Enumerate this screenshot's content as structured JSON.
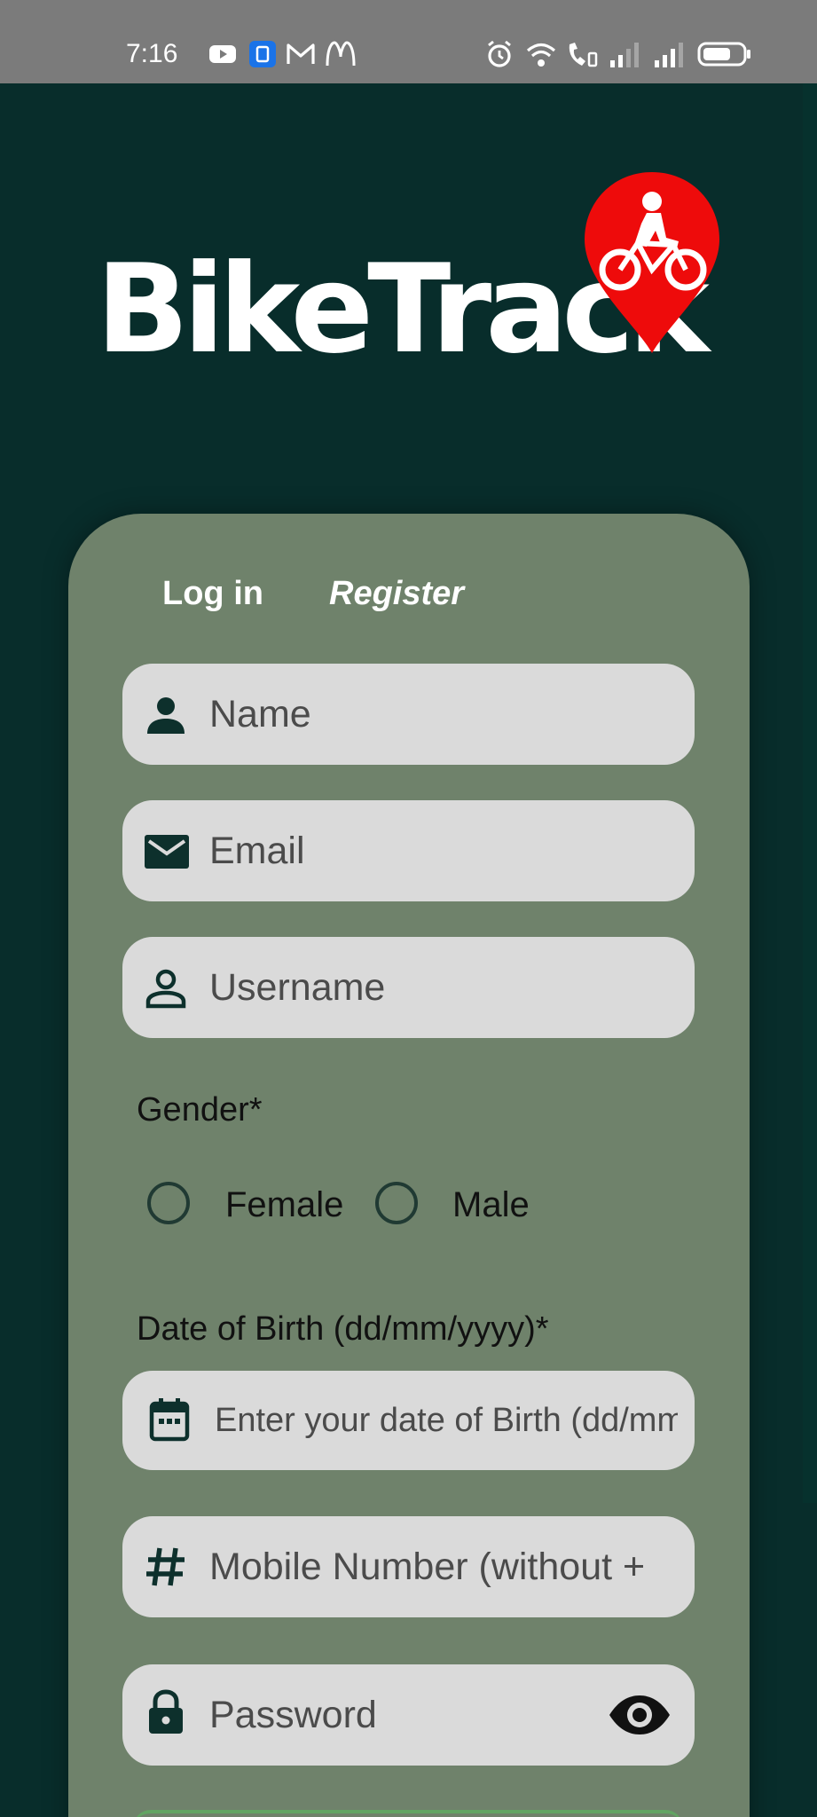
{
  "status_bar": {
    "time": "7:16",
    "left_icons": [
      "youtube-icon",
      "app-badge-icon",
      "gmail-icon",
      "mcdonalds-icon"
    ],
    "right_icons": [
      "alarm-icon",
      "wifi-icon",
      "wifi-call-icon",
      "signal-icon",
      "signal-icon",
      "battery-icon"
    ]
  },
  "brand": {
    "name": "BikeTrack",
    "pin_color": "#ee0b0b"
  },
  "auth_tabs": {
    "login_label": "Log in",
    "register_label": "Register",
    "active": "Register"
  },
  "form": {
    "name_placeholder": "Name",
    "email_placeholder": "Email",
    "username_placeholder": "Username",
    "gender_label": "Gender*",
    "gender_options": [
      "Female",
      "Male"
    ],
    "dob_label": "Date of Birth (dd/mm/yyyy)*",
    "dob_placeholder": "Enter your date of Birth (dd/mm/yyyy)",
    "mobile_placeholder": "Mobile Number (without +",
    "password_placeholder": "Password"
  },
  "colors": {
    "background": "#082d2b",
    "panel": "#6f826b",
    "field": "#dadada",
    "icon": "#0d302c",
    "status_bar": "#7b7b7b"
  }
}
